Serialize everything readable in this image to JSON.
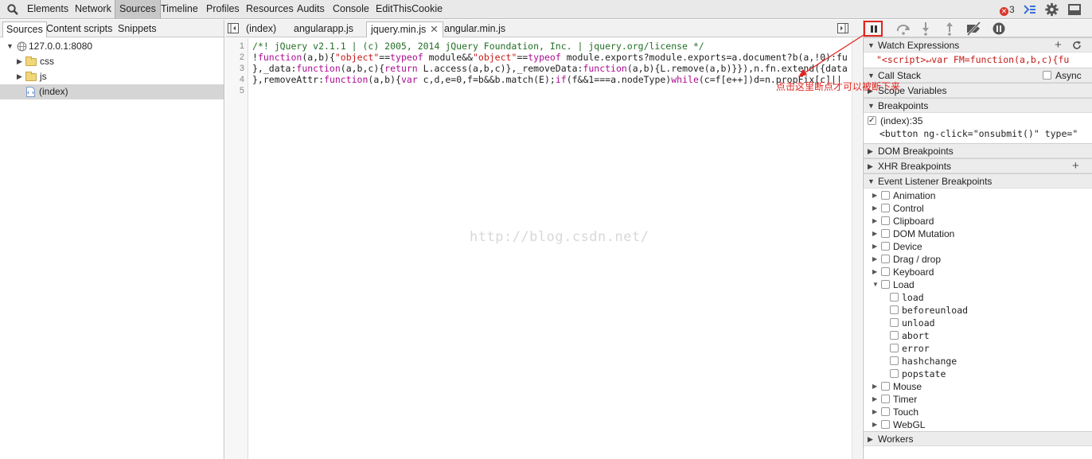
{
  "toolbar": {
    "tabs": [
      "Elements",
      "Network",
      "Sources",
      "Timeline",
      "Profiles",
      "Resources",
      "Audits",
      "Console",
      "EditThisCookie"
    ],
    "active_tab": "Sources",
    "error_count": "3",
    "error_icon": "error-circle-icon",
    "icons": [
      "search-icon",
      "console-drawer-icon",
      "gear-icon",
      "dock-icon"
    ]
  },
  "navigator": {
    "tabs": [
      "Sources",
      "Content scripts",
      "Snippets"
    ],
    "active_tab": "Sources",
    "tree": {
      "host": "127.0.0.1:8080",
      "folders": [
        "css",
        "js"
      ],
      "file": "(index)"
    }
  },
  "editor": {
    "tabs": [
      "(index)",
      "angularapp.js",
      "jquery.min.js",
      "angular.min.js"
    ],
    "active_tab": "jquery.min.js",
    "close_glyph": "✕",
    "line_numbers": [
      "1",
      "2",
      "3",
      "4",
      "5"
    ],
    "code": [
      "/*! jQuery v2.1.1 | (c) 2005, 2014 jQuery Foundation, Inc. | jquery.org/license */",
      "!function(a,b){\"object\"==typeof module&&\"object\"==typeof module.exports?module.exports=a.document?b(a,!0):fu",
      "},_data:function(a,b,c){return L.access(a,b,c)},_removeData:function(a,b){L.remove(a,b)}}),n.fn.extend({data",
      "},removeAttr:function(a,b){var c,d,e=0,f=b&&b.match(E);if(f&&1===a.nodeType)while(c=f[e++])d=n.propFix[c]||",
      ""
    ],
    "watermark": "http://blog.csdn.net/"
  },
  "debugger": {
    "buttons": [
      "pause-icon",
      "step-over-icon",
      "step-into-icon",
      "step-out-icon",
      "deactivate-breakpoints-icon",
      "pause-on-exceptions-icon"
    ],
    "watch_title": "Watch Expressions",
    "watch_value": "\"<script>↵var FM=function(a,b,c){fu",
    "callstack_title": "Call Stack",
    "async_label": "Async",
    "scope_title": "Scope Variables",
    "breakpoints_title": "Breakpoints",
    "breakpoint_location": "(index):35",
    "breakpoint_code": "<button ng-click=\"onsubmit()\" type=\"",
    "dom_bp_title": "DOM Breakpoints",
    "xhr_bp_title": "XHR Breakpoints",
    "event_bp_title": "Event Listener Breakpoints",
    "event_categories_top": [
      "Animation",
      "Control",
      "Clipboard",
      "DOM Mutation",
      "Device",
      "Drag / drop",
      "Keyboard"
    ],
    "load_category": "Load",
    "load_events": [
      "load",
      "beforeunload",
      "unload",
      "abort",
      "error",
      "hashchange",
      "popstate"
    ],
    "event_categories_bottom": [
      "Mouse",
      "Timer",
      "Touch",
      "WebGL"
    ],
    "workers_title": "Workers"
  },
  "annotation": {
    "text": "点击这里断点才可以被断下来",
    "color": "#e0261f"
  }
}
